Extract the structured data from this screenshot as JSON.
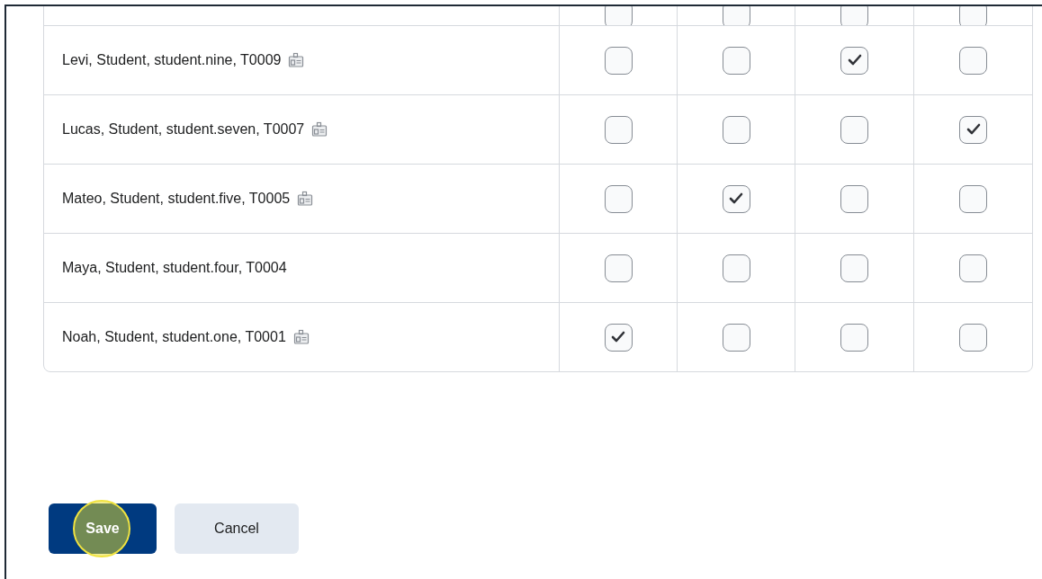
{
  "table": {
    "partial_row": {
      "checkboxes": [
        {
          "checked": false
        },
        {
          "checked": false
        },
        {
          "checked": false
        },
        {
          "checked": false
        }
      ]
    },
    "rows": [
      {
        "name": "Levi, Student, student.nine, T0009",
        "id_icon": true,
        "checkboxes": [
          {
            "checked": false
          },
          {
            "checked": false
          },
          {
            "checked": true
          },
          {
            "checked": false
          }
        ]
      },
      {
        "name": "Lucas, Student, student.seven, T0007",
        "id_icon": true,
        "checkboxes": [
          {
            "checked": false
          },
          {
            "checked": false
          },
          {
            "checked": false
          },
          {
            "checked": true
          }
        ]
      },
      {
        "name": "Mateo, Student, student.five, T0005",
        "id_icon": true,
        "checkboxes": [
          {
            "checked": false
          },
          {
            "checked": true
          },
          {
            "checked": false
          },
          {
            "checked": false
          }
        ]
      },
      {
        "name": "Maya, Student, student.four, T0004",
        "id_icon": false,
        "checkboxes": [
          {
            "checked": false
          },
          {
            "checked": false
          },
          {
            "checked": false
          },
          {
            "checked": false
          }
        ]
      },
      {
        "name": "Noah, Student, student.one, T0001",
        "id_icon": true,
        "checkboxes": [
          {
            "checked": true
          },
          {
            "checked": false
          },
          {
            "checked": false
          },
          {
            "checked": false
          }
        ]
      }
    ]
  },
  "buttons": [
    {
      "label": "Save",
      "kind": "primary",
      "highlighted": true
    },
    {
      "label": "Cancel",
      "kind": "secondary",
      "highlighted": false
    }
  ]
}
